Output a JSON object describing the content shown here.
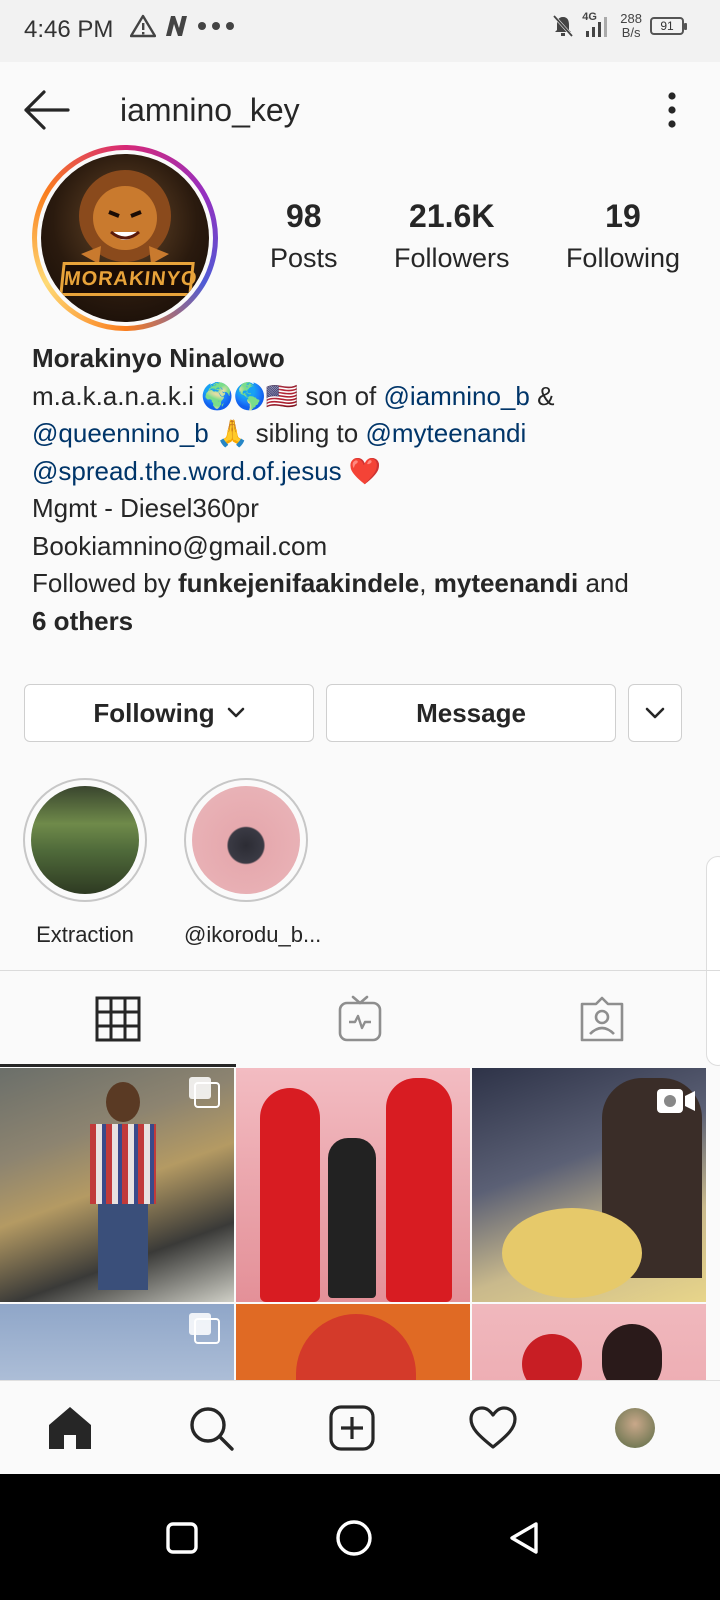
{
  "status_bar": {
    "time": "4:46 PM",
    "network": "4G",
    "speed_value": "288",
    "speed_unit": "B/s",
    "battery": "91"
  },
  "header": {
    "username": "iamnino_key"
  },
  "stats": [
    {
      "value": "98",
      "label": "Posts"
    },
    {
      "value": "21.6K",
      "label": "Followers"
    },
    {
      "value": "19",
      "label": "Following"
    }
  ],
  "avatar_text": "MORAKINYO",
  "bio": {
    "name": "Morakinyo Ninalowo",
    "line1_text": "m.a.k.a.n.a.k.i ",
    "line1_emoji": "🌍🌎🇺🇸",
    "line1_mid": " son  of ",
    "line1_link": "@iamnino_b",
    "line1_end": "  &",
    "line2_link1": "@queennino_b",
    "line2_emoji": " 🙏",
    "line2_mid": " sibling to ",
    "line2_link2": "@myteenandi",
    "line3_link": "@spread.the.word.of.jesus",
    "line3_emoji": " ❤️",
    "line4": "Mgmt - Diesel360pr",
    "line5": "Bookiamnino@gmail.com",
    "followed_prefix": "Followed by ",
    "followed_user1": "funkejenifaakindele",
    "followed_sep": ", ",
    "followed_user2": "myteenandi",
    "followed_and": " and",
    "followed_others": "6 others"
  },
  "buttons": {
    "following": "Following",
    "message": "Message"
  },
  "highlights": [
    {
      "label": "Extraction"
    },
    {
      "label": "@ikorodu_b..."
    }
  ],
  "colors": {
    "link": "#003569",
    "text": "#262626",
    "border": "#dbdbdb"
  }
}
